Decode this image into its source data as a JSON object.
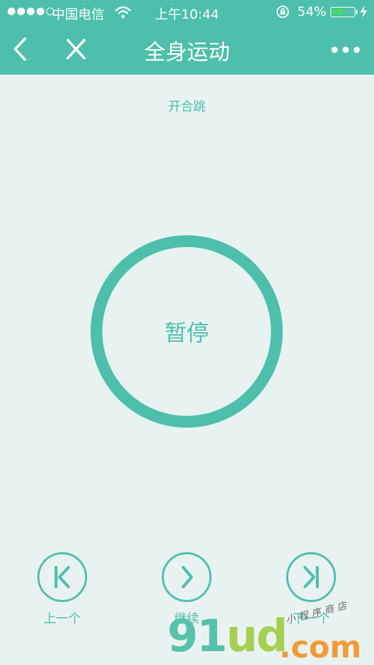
{
  "status_bar": {
    "carrier": "中国电信",
    "time": "上午10:44",
    "battery_percent": "54%",
    "battery_level": 0.54,
    "signal_bars_filled": 4,
    "signal_bars_total": 5
  },
  "nav": {
    "title": "全身运动",
    "back_icon": "chevron-left-icon",
    "close_icon": "close-icon",
    "more_icon": "more-dots-icon"
  },
  "exercise": {
    "name": "开合跳"
  },
  "timer": {
    "center_label": "暂停"
  },
  "controls": {
    "prev_label": "上一个",
    "resume_label": "继续",
    "next_label": "下一个"
  },
  "watermark": {
    "brand_a": "91",
    "brand_b": "ud",
    "domain": ".com",
    "tagline": "小程序商店"
  },
  "colors": {
    "accent": "#4dbfab",
    "background": "#e8f3f1",
    "battery": "#4cd964"
  }
}
